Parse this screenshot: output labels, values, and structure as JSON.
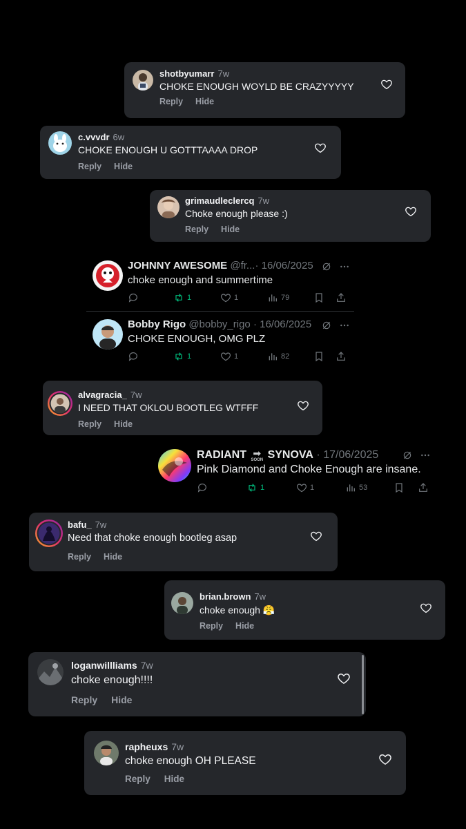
{
  "ig_labels": {
    "reply": "Reply",
    "hide": "Hide"
  },
  "colors": {
    "ig_card": "#25272b",
    "muted": "#9a9ea6",
    "retweet_green": "#00ba7c",
    "x_muted": "#71767b"
  },
  "comments": [
    {
      "username": "shotbyumarr",
      "age": "7w",
      "text": "CHOKE ENOUGH WOYLD BE CRAZYYYYY"
    },
    {
      "username": "c.vvvdr",
      "age": "6w",
      "text": "CHOKE ENOUGH U GOTTTAAAA DROP"
    },
    {
      "username": "grimaudleclercq",
      "age": "7w",
      "text": "Choke enough please :)"
    },
    {
      "username": "alvagracia_",
      "age": "7w",
      "text": "I NEED THAT OKLOU BOOTLEG WTFFF"
    },
    {
      "username": "bafu_",
      "age": "7w",
      "text": "Need that choke enough bootleg asap"
    },
    {
      "username": "brian.brown",
      "age": "7w",
      "text": "choke enough 😤"
    },
    {
      "username": "loganwillliams",
      "age": "7w",
      "text": "choke enough!!!!"
    },
    {
      "username": "rapheuxs",
      "age": "7w",
      "text": "choke enough OH PLEASE"
    }
  ],
  "tweets": [
    {
      "name": "JOHNNY AWESOME",
      "handle": "@fr...",
      "date": "· 16/06/2025",
      "text": "choke enough and summertime",
      "reposts": "1",
      "likes": "1",
      "views": "79"
    },
    {
      "name": "Bobby Rigo",
      "handle": "@bobby_rigo",
      "date": "· 16/06/2025",
      "text": "CHOKE ENOUGH, OMG PLZ",
      "reposts": "1",
      "likes": "1",
      "views": "82"
    },
    {
      "name": "RADIANT",
      "name_arrow": "➡",
      "name_arrow_badge": "SOON",
      "name2": "SYNOVA",
      "date": "· 17/06/2025",
      "text": "Pink Diamond and Choke Enough are insane.",
      "reposts": "1",
      "likes": "1",
      "views": "53"
    }
  ],
  "icons": {
    "heart": "heart-icon",
    "reply": "reply-icon",
    "repost": "repost-icon",
    "like": "like-icon",
    "views": "views-icon",
    "bookmark": "bookmark-icon",
    "share": "share-icon",
    "grok": "grok-icon",
    "more": "more-icon"
  }
}
